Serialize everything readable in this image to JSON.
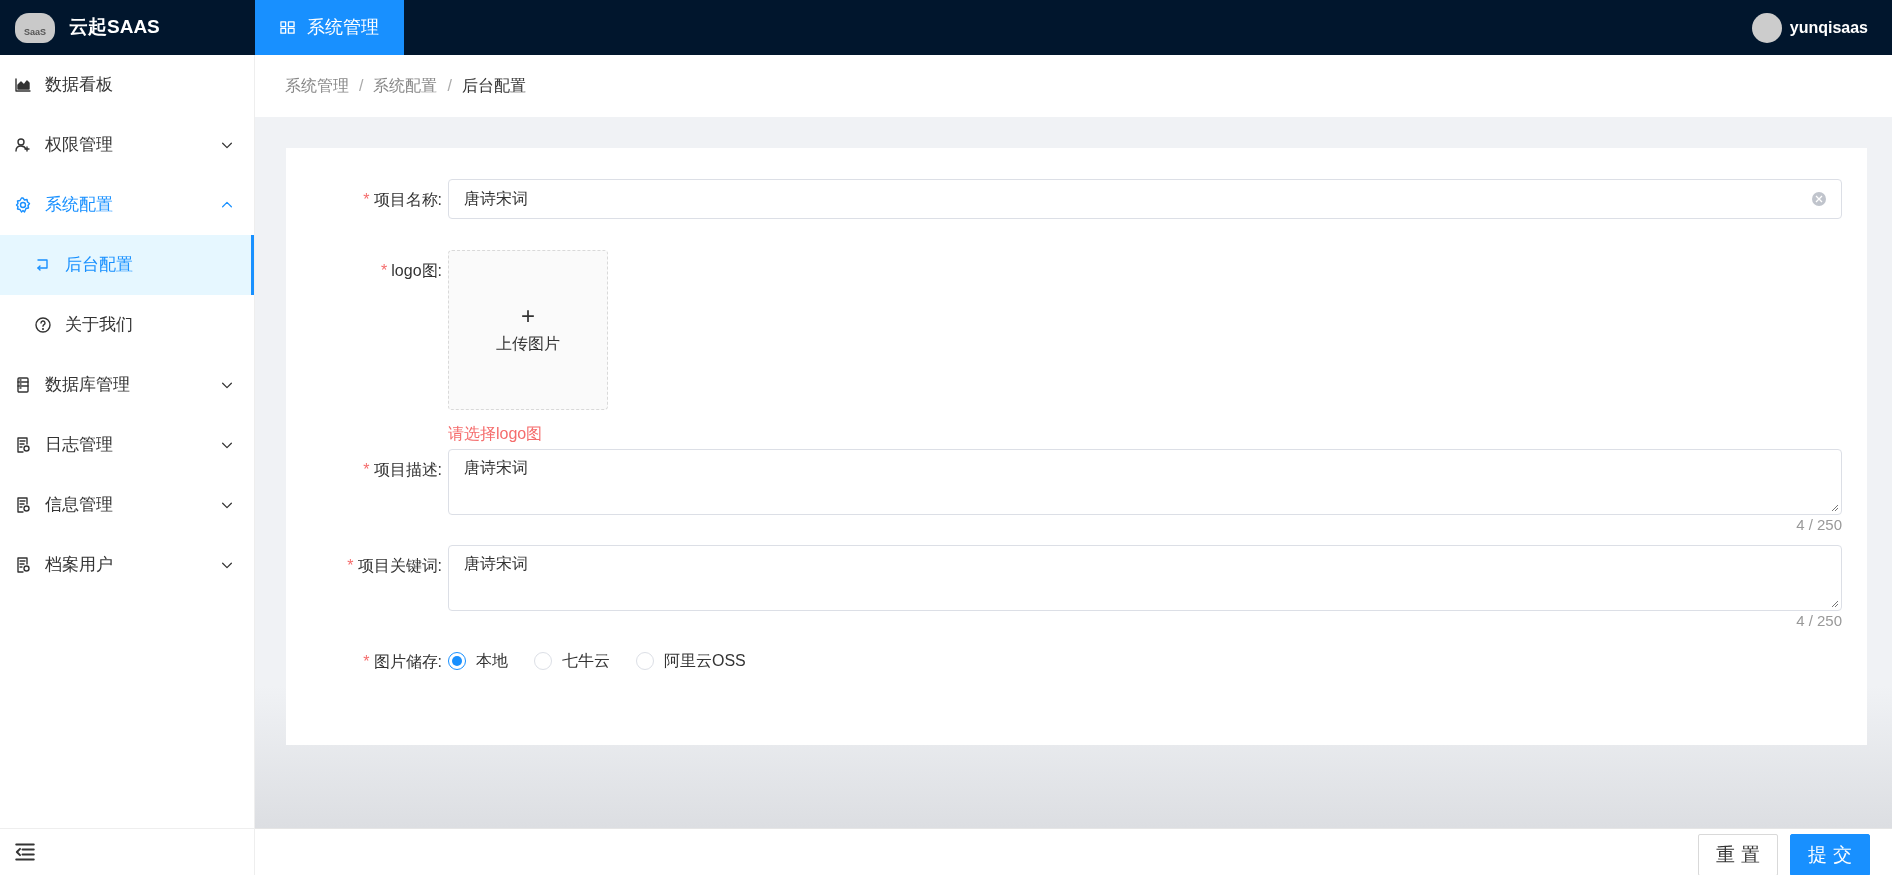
{
  "header": {
    "brand": "云起SAAS",
    "logo_text": "SaaS",
    "top_tabs": [
      {
        "label": "系统管理",
        "selected": true
      }
    ],
    "user": {
      "name": "yunqisaas"
    }
  },
  "sidebar": {
    "items": [
      {
        "label": "数据看板",
        "kind": "leaf",
        "selected": false
      },
      {
        "label": "权限管理",
        "kind": "group",
        "expanded": false,
        "selected": false
      },
      {
        "label": "系统配置",
        "kind": "group",
        "expanded": true,
        "selected": true,
        "children": [
          {
            "label": "后台配置",
            "selected": true
          },
          {
            "label": "关于我们",
            "selected": false
          }
        ]
      },
      {
        "label": "数据库管理",
        "kind": "group",
        "expanded": false,
        "selected": false
      },
      {
        "label": "日志管理",
        "kind": "group",
        "expanded": false,
        "selected": false
      },
      {
        "label": "信息管理",
        "kind": "group",
        "expanded": false,
        "selected": false
      },
      {
        "label": "档案用户",
        "kind": "group",
        "expanded": false,
        "selected": false
      }
    ]
  },
  "breadcrumb": {
    "separator": "/",
    "items": [
      "系统管理",
      "系统配置",
      "后台配置"
    ]
  },
  "form": {
    "fields": [
      {
        "kind": "input",
        "mark": "*",
        "label": "项目名称:",
        "value": "唐诗宋词"
      },
      {
        "kind": "upload",
        "mark": "*",
        "label": "logo图:",
        "plus": "+",
        "text": "上传图片",
        "error": "请选择logo图"
      },
      {
        "kind": "textarea",
        "mark": "*",
        "label": "项目描述:",
        "value": "唐诗宋词",
        "counter": "4 / 250"
      },
      {
        "kind": "textarea",
        "mark": "*",
        "label": "项目关键词:",
        "value": "唐诗宋词",
        "counter": "4 / 250"
      },
      {
        "kind": "radio",
        "mark": "*",
        "label": "图片储存:",
        "options": [
          {
            "label": "本地",
            "selected": true
          },
          {
            "label": "七牛云",
            "selected": false
          },
          {
            "label": "阿里云OSS",
            "selected": false
          }
        ]
      }
    ]
  },
  "footer": {
    "buttons": [
      {
        "label": "重 置",
        "kind": "default"
      },
      {
        "label": "提 交",
        "kind": "primary"
      }
    ]
  }
}
